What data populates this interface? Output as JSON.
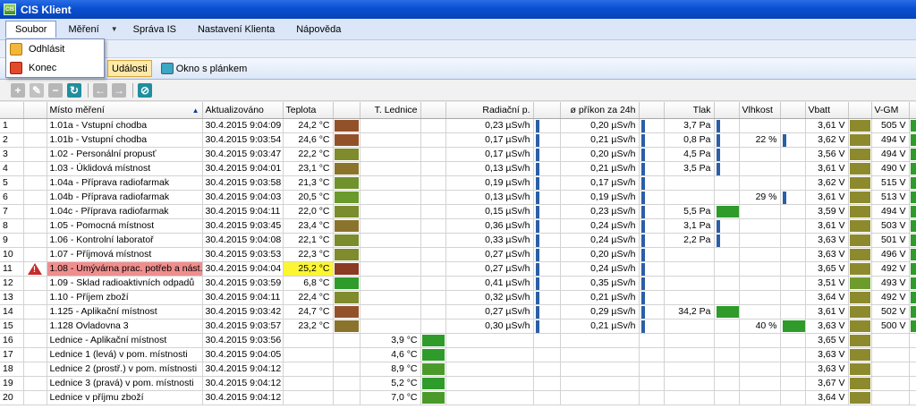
{
  "app": {
    "title": "CIS Klient",
    "logo": "CIS"
  },
  "menu": [
    {
      "label": "Soubor"
    },
    {
      "label": "Měření"
    },
    {
      "label": "Správa IS"
    },
    {
      "label": "Nastavení Klienta"
    },
    {
      "label": "Nápověda"
    }
  ],
  "dropdown": [
    {
      "label": "Odhlásit",
      "icon": "logout-icon"
    },
    {
      "label": "Konec",
      "icon": "exit-icon"
    }
  ],
  "tabs": [
    {
      "label": "Události"
    },
    {
      "label": "Okno s plánkem"
    }
  ],
  "columns": [
    "Místo měření",
    "Aktualizováno",
    "Teplota",
    "T. Lednice",
    "Radiační p.",
    "ø příkon za 24h",
    "Tlak",
    "Vlhkost",
    "Vbatt",
    "V-GM"
  ],
  "colors": {
    "brown": "#8b4b24",
    "olive": "#8d8a2e",
    "green": "#2e9b2a",
    "blue": "#2b5fa6",
    "alarm": "#f08e8e",
    "highlight": "#fcf534"
  },
  "rows": [
    {
      "n": "1",
      "place": "1.01a - Vstupní chodba",
      "upd": "30.4.2015 9:04:09",
      "temp": "24,2 °C",
      "tc": "#93512a",
      "led": "",
      "lc": "",
      "rad": "0,23 µSv/h",
      "dose": "0,20 µSv/h",
      "tlak": "3,7 Pa",
      "tl": true,
      "vlh": "",
      "vl": false,
      "vb": "3,61 V",
      "vbc": "#8d8a2e",
      "vgm": "505 V",
      "vgc": "#2e9b2a",
      "alarm": false
    },
    {
      "n": "2",
      "place": "1.01b - Vstupní chodba",
      "upd": "30.4.2015 9:03:54",
      "temp": "24,6 °C",
      "tc": "#93512a",
      "led": "",
      "lc": "",
      "rad": "0,17 µSv/h",
      "dose": "0,21 µSv/h",
      "tlak": "0,8 Pa",
      "tl": true,
      "vlh": "22 %",
      "vl": true,
      "vb": "3,62 V",
      "vbc": "#8d8a2e",
      "vgm": "494 V",
      "vgc": "#2e9b2a",
      "alarm": false
    },
    {
      "n": "3",
      "place": "1.02 - Personální propusť",
      "upd": "30.4.2015 9:03:47",
      "temp": "22,2 °C",
      "tc": "#7f8b2c",
      "led": "",
      "lc": "",
      "rad": "0,17 µSv/h",
      "dose": "0,20 µSv/h",
      "tlak": "4,5 Pa",
      "tl": true,
      "vlh": "",
      "vl": false,
      "vb": "3,56 V",
      "vbc": "#8d8a2e",
      "vgm": "494 V",
      "vgc": "#2e9b2a",
      "alarm": false
    },
    {
      "n": "4",
      "place": "1.03 - Úklidová místnost",
      "upd": "30.4.2015 9:04:01",
      "temp": "23,1 °C",
      "tc": "#8a742c",
      "led": "",
      "lc": "",
      "rad": "0,13 µSv/h",
      "dose": "0,21 µSv/h",
      "tlak": "3,5 Pa",
      "tl": true,
      "vlh": "",
      "vl": false,
      "vb": "3,61 V",
      "vbc": "#8d8a2e",
      "vgm": "490 V",
      "vgc": "#2e9b2a",
      "alarm": false
    },
    {
      "n": "5",
      "place": "1.04a - Příprava radiofarmak",
      "upd": "30.4.2015 9:03:58",
      "temp": "21,3 °C",
      "tc": "#6f922c",
      "led": "",
      "lc": "",
      "rad": "0,19 µSv/h",
      "dose": "0,17 µSv/h",
      "tlak": "",
      "tl": false,
      "vlh": "",
      "vl": false,
      "vb": "3,62 V",
      "vbc": "#8d8a2e",
      "vgm": "515 V",
      "vgc": "#2e9b2a",
      "alarm": false
    },
    {
      "n": "6",
      "place": "1.04b - Příprava radiofarmak",
      "upd": "30.4.2015 9:04:03",
      "temp": "20,5 °C",
      "tc": "#6a9a2c",
      "led": "",
      "lc": "",
      "rad": "0,13 µSv/h",
      "dose": "0,19 µSv/h",
      "tlak": "",
      "tl": false,
      "vlh": "29 %",
      "vl": true,
      "vb": "3,61 V",
      "vbc": "#8d8a2e",
      "vgm": "513 V",
      "vgc": "#2e9b2a",
      "alarm": false
    },
    {
      "n": "7",
      "place": "1.04c - Příprava radiofarmak",
      "upd": "30.4.2015 9:04:11",
      "temp": "22,0 °C",
      "tc": "#7a8c2c",
      "led": "",
      "lc": "",
      "rad": "0,15 µSv/h",
      "dose": "0,23 µSv/h",
      "tlak": "5,5 Pa",
      "tl": true,
      "vlh": "",
      "vl": false,
      "vb": "3,59 V",
      "vbc": "#8d8a2e",
      "vgm": "494 V",
      "vgc": "#2e9b2a",
      "alarm": false
    },
    {
      "n": "8",
      "place": "1.05 - Pomocná místnost",
      "upd": "30.4.2015 9:03:45",
      "temp": "23,4 °C",
      "tc": "#8a742c",
      "led": "",
      "lc": "",
      "rad": "0,36 µSv/h",
      "dose": "0,24 µSv/h",
      "tlak": "3,1 Pa",
      "tl": true,
      "vlh": "",
      "vl": false,
      "vb": "3,61 V",
      "vbc": "#8d8a2e",
      "vgm": "503 V",
      "vgc": "#2e9b2a",
      "alarm": false
    },
    {
      "n": "9",
      "place": "1.06 - Kontrolní laboratoř",
      "upd": "30.4.2015 9:04:08",
      "temp": "22,1 °C",
      "tc": "#7a8c2c",
      "led": "",
      "lc": "",
      "rad": "0,33 µSv/h",
      "dose": "0,24 µSv/h",
      "tlak": "2,2 Pa",
      "tl": true,
      "vlh": "",
      "vl": false,
      "vb": "3,63 V",
      "vbc": "#8d8a2e",
      "vgm": "501 V",
      "vgc": "#2e9b2a",
      "alarm": false
    },
    {
      "n": "10",
      "place": "1.07 - Příjmová místnost",
      "upd": "30.4.2015 9:03:53",
      "temp": "22,3 °C",
      "tc": "#7f8b2c",
      "led": "",
      "lc": "",
      "rad": "0,27 µSv/h",
      "dose": "0,20 µSv/h",
      "tlak": "",
      "tl": false,
      "vlh": "",
      "vl": false,
      "vb": "3,63 V",
      "vbc": "#8d8a2e",
      "vgm": "496 V",
      "vgc": "#2e9b2a",
      "alarm": false
    },
    {
      "n": "11",
      "place": "1.08 - Umývárna prac. potřeb a nást.",
      "upd": "30.4.2015 9:04:04",
      "temp": "25,2 °C",
      "tc": "#8b3a24",
      "led": "",
      "lc": "",
      "rad": "0,27 µSv/h",
      "dose": "0,24 µSv/h",
      "tlak": "",
      "tl": false,
      "vlh": "",
      "vl": false,
      "vb": "3,65 V",
      "vbc": "#8d8a2e",
      "vgm": "492 V",
      "vgc": "#2e9b2a",
      "alarm": true
    },
    {
      "n": "12",
      "place": "1.09 - Sklad radioaktivních odpadů",
      "upd": "30.4.2015 9:03:59",
      "temp": "6,8 °C",
      "tc": "#2e9b2a",
      "led": "",
      "lc": "",
      "rad": "0,41 µSv/h",
      "dose": "0,35 µSv/h",
      "tlak": "",
      "tl": false,
      "vlh": "",
      "vl": false,
      "vb": "3,51 V",
      "vbc": "#6e9c2c",
      "vgm": "493 V",
      "vgc": "#2e9b2a",
      "alarm": false
    },
    {
      "n": "13",
      "place": "1.10 - Příjem zboží",
      "upd": "30.4.2015 9:04:11",
      "temp": "22,4 °C",
      "tc": "#7f8b2c",
      "led": "",
      "lc": "",
      "rad": "0,32 µSv/h",
      "dose": "0,21 µSv/h",
      "tlak": "",
      "tl": false,
      "vlh": "",
      "vl": false,
      "vb": "3,64 V",
      "vbc": "#8d8a2e",
      "vgm": "492 V",
      "vgc": "#2e9b2a",
      "alarm": false
    },
    {
      "n": "14",
      "place": "1.125 - Aplikační místnost",
      "upd": "30.4.2015 9:03:42",
      "temp": "24,7 °C",
      "tc": "#93512a",
      "led": "",
      "lc": "",
      "rad": "0,27 µSv/h",
      "dose": "0,29 µSv/h",
      "tlak": "34,2 Pa",
      "tl": true,
      "vlh": "",
      "vl": false,
      "vb": "3,61 V",
      "vbc": "#8d8a2e",
      "vgm": "502 V",
      "vgc": "#2e9b2a",
      "alarm": false
    },
    {
      "n": "15",
      "place": "1.128 Ovladovna 3",
      "upd": "30.4.2015 9:03:57",
      "temp": "23,2 °C",
      "tc": "#8a742c",
      "led": "",
      "lc": "",
      "rad": "0,30 µSv/h",
      "dose": "0,21 µSv/h",
      "tlak": "",
      "tl": false,
      "vlh": "40 %",
      "vl": true,
      "vb": "3,63 V",
      "vbc": "#8d8a2e",
      "vgm": "500 V",
      "vgc": "#2e9b2a",
      "alarm": false
    },
    {
      "n": "16",
      "place": "Lednice - Aplikační místnost",
      "upd": "30.4.2015 9:03:56",
      "temp": "",
      "tc": "",
      "led": "3,9 °C",
      "lc": "#2e9b2a",
      "rad": "",
      "dose": "",
      "tlak": "",
      "tl": false,
      "vlh": "",
      "vl": false,
      "vb": "3,65 V",
      "vbc": "#8d8a2e",
      "vgm": "",
      "vgc": "",
      "alarm": false
    },
    {
      "n": "17",
      "place": "Lednice 1 (levá) v pom. místnosti",
      "upd": "30.4.2015 9:04:05",
      "temp": "",
      "tc": "",
      "led": "4,6 °C",
      "lc": "#2e9b2a",
      "rad": "",
      "dose": "",
      "tlak": "",
      "tl": false,
      "vlh": "",
      "vl": false,
      "vb": "3,63 V",
      "vbc": "#8d8a2e",
      "vgm": "",
      "vgc": "",
      "alarm": false
    },
    {
      "n": "18",
      "place": "Lednice 2 (prostř.) v pom. místnosti",
      "upd": "30.4.2015 9:04:12",
      "temp": "",
      "tc": "",
      "led": "8,9 °C",
      "lc": "#4a9a2a",
      "rad": "",
      "dose": "",
      "tlak": "",
      "tl": false,
      "vlh": "",
      "vl": false,
      "vb": "3,63 V",
      "vbc": "#8d8a2e",
      "vgm": "",
      "vgc": "",
      "alarm": false
    },
    {
      "n": "19",
      "place": "Lednice 3 (pravá) v pom. místnosti",
      "upd": "30.4.2015 9:04:12",
      "temp": "",
      "tc": "",
      "led": "5,2 °C",
      "lc": "#2e9b2a",
      "rad": "",
      "dose": "",
      "tlak": "",
      "tl": false,
      "vlh": "",
      "vl": false,
      "vb": "3,67 V",
      "vbc": "#8d8a2e",
      "vgm": "",
      "vgc": "",
      "alarm": false
    },
    {
      "n": "20",
      "place": "Lednice v příjmu zboží",
      "upd": "30.4.2015 9:04:12",
      "temp": "",
      "tc": "",
      "led": "7,0 °C",
      "lc": "#4a9a2a",
      "rad": "",
      "dose": "",
      "tlak": "",
      "tl": false,
      "vlh": "",
      "vl": false,
      "vb": "3,64 V",
      "vbc": "#8d8a2e",
      "vgm": "",
      "vgc": "",
      "alarm": false
    }
  ]
}
